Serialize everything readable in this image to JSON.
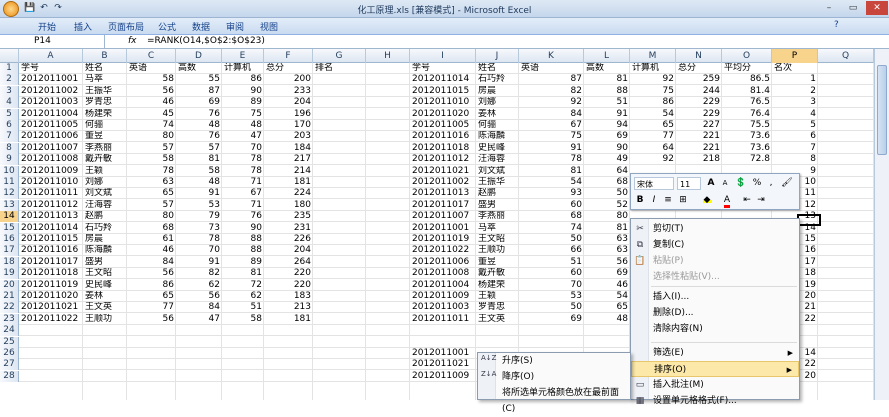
{
  "window": {
    "title": "化工原理.xls [兼容模式] - Microsoft Excel",
    "min": "–",
    "restore": "▭",
    "close": "✕"
  },
  "ribbon": {
    "tabs": [
      "开始",
      "插入",
      "页面布局",
      "公式",
      "数据",
      "审阅",
      "视图"
    ]
  },
  "formula_bar": {
    "name_box": "P14",
    "fx": "fx",
    "formula": "=RANK(O14,$O$2:$O$23)"
  },
  "columns": [
    "A",
    "B",
    "C",
    "D",
    "E",
    "F",
    "G",
    "H",
    "I",
    "J",
    "K",
    "L",
    "M",
    "N",
    "O",
    "P",
    "Q"
  ],
  "selected_column": "P",
  "selected_row": 14,
  "rows": [
    {
      "n": "1",
      "A": "学号",
      "B": "姓名",
      "C": "英语",
      "D": "高数",
      "E": "计算机",
      "F": "总分",
      "G": "排名",
      "I": "学号",
      "J": "姓名",
      "K": "英语",
      "L": "高数",
      "M": "计算机",
      "N": "总分",
      "O": "平均分",
      "P": "名次"
    },
    {
      "n": "2",
      "A": "2012011001",
      "B": "马萃",
      "C": "58",
      "D": "55",
      "E": "86",
      "F": "200",
      "I": "2012011014",
      "J": "石巧羚",
      "K": "87",
      "L": "81",
      "M": "92",
      "N": "259",
      "O": "86.5",
      "P": "1"
    },
    {
      "n": "3",
      "A": "2012011002",
      "B": "王振华",
      "C": "56",
      "D": "87",
      "E": "90",
      "F": "233",
      "I": "2012011015",
      "J": "房晨",
      "K": "82",
      "L": "88",
      "M": "75",
      "N": "244",
      "O": "81.4",
      "P": "2"
    },
    {
      "n": "4",
      "A": "2012011003",
      "B": "罗青忠",
      "C": "46",
      "D": "69",
      "E": "89",
      "F": "204",
      "I": "2012011010",
      "J": "刘娜",
      "K": "92",
      "L": "51",
      "M": "86",
      "N": "229",
      "O": "76.5",
      "P": "3"
    },
    {
      "n": "5",
      "A": "2012011004",
      "B": "杨建荣",
      "C": "45",
      "D": "76",
      "E": "75",
      "F": "196",
      "I": "2012011020",
      "J": "姜林",
      "K": "84",
      "L": "91",
      "M": "54",
      "N": "229",
      "O": "76.4",
      "P": "4"
    },
    {
      "n": "6",
      "A": "2012011005",
      "B": "何骊",
      "C": "74",
      "D": "48",
      "E": "48",
      "F": "170",
      "I": "2012011005",
      "J": "何骊",
      "K": "67",
      "L": "94",
      "M": "65",
      "N": "227",
      "O": "75.5",
      "P": "5"
    },
    {
      "n": "7",
      "A": "2012011006",
      "B": "董昱",
      "C": "80",
      "D": "76",
      "E": "47",
      "F": "203",
      "I": "2012011016",
      "J": "陈海麟",
      "K": "75",
      "L": "69",
      "M": "77",
      "N": "221",
      "O": "73.6",
      "P": "6"
    },
    {
      "n": "8",
      "A": "2012011007",
      "B": "李燕丽",
      "C": "57",
      "D": "57",
      "E": "70",
      "F": "184",
      "I": "2012011018",
      "J": "史民峰",
      "K": "91",
      "L": "90",
      "M": "64",
      "N": "221",
      "O": "73.6",
      "P": "7"
    },
    {
      "n": "9",
      "A": "2012011008",
      "B": "戴卉敏",
      "C": "58",
      "D": "81",
      "E": "78",
      "F": "217",
      "I": "2012011012",
      "J": "汪海蓉",
      "K": "78",
      "L": "49",
      "M": "92",
      "N": "218",
      "O": "72.8",
      "P": "8"
    },
    {
      "n": "10",
      "A": "2012011009",
      "B": "王颖",
      "C": "78",
      "D": "58",
      "E": "78",
      "F": "214",
      "I": "2012011021",
      "J": "刘文斌",
      "K": "81",
      "L": "64",
      "P": "9"
    },
    {
      "n": "11",
      "A": "2012011010",
      "B": "刘娜",
      "C": "63",
      "D": "48",
      "E": "71",
      "F": "181",
      "I": "2012011002",
      "J": "王振华",
      "K": "54",
      "L": "68",
      "P": "10"
    },
    {
      "n": "12",
      "A": "2012011011",
      "B": "刘文斌",
      "C": "65",
      "D": "91",
      "E": "67",
      "F": "224",
      "I": "2012011013",
      "J": "赵鹏",
      "K": "93",
      "L": "50",
      "P": "11"
    },
    {
      "n": "13",
      "A": "2012011012",
      "B": "汪海蓉",
      "C": "57",
      "D": "53",
      "E": "71",
      "F": "180",
      "I": "2012011017",
      "J": "盛男",
      "K": "60",
      "L": "52",
      "P": "12"
    },
    {
      "n": "14",
      "A": "2012011013",
      "B": "赵鹏",
      "C": "80",
      "D": "79",
      "E": "76",
      "F": "235",
      "I": "2012011007",
      "J": "李燕丽",
      "K": "68",
      "L": "80",
      "P": "13"
    },
    {
      "n": "15",
      "A": "2012011014",
      "B": "石巧羚",
      "C": "68",
      "D": "73",
      "E": "90",
      "F": "231",
      "I": "2012011001",
      "J": "马萃",
      "K": "74",
      "L": "81",
      "P": "14"
    },
    {
      "n": "16",
      "A": "2012011015",
      "B": "房晨",
      "C": "61",
      "D": "78",
      "E": "88",
      "F": "226",
      "I": "2012011019",
      "J": "王文昭",
      "K": "50",
      "L": "63",
      "P": "15"
    },
    {
      "n": "17",
      "A": "2012011016",
      "B": "陈海麟",
      "C": "46",
      "D": "70",
      "E": "88",
      "F": "204",
      "I": "2012011022",
      "J": "王顺功",
      "K": "66",
      "L": "63",
      "P": "16"
    },
    {
      "n": "18",
      "A": "2012011017",
      "B": "盛男",
      "C": "84",
      "D": "91",
      "E": "89",
      "F": "264",
      "I": "2012011006",
      "J": "董昱",
      "K": "51",
      "L": "56",
      "P": "17"
    },
    {
      "n": "19",
      "A": "2012011018",
      "B": "王文昭",
      "C": "56",
      "D": "82",
      "E": "81",
      "F": "220",
      "I": "2012011008",
      "J": "戴卉敏",
      "K": "60",
      "L": "69",
      "P": "18"
    },
    {
      "n": "20",
      "A": "2012011019",
      "B": "史民峰",
      "C": "86",
      "D": "62",
      "E": "72",
      "F": "220",
      "I": "2012011004",
      "J": "杨建荣",
      "K": "70",
      "L": "46",
      "P": "19"
    },
    {
      "n": "21",
      "A": "2012011020",
      "B": "姜林",
      "C": "65",
      "D": "56",
      "E": "62",
      "F": "183",
      "I": "2012011009",
      "J": "王颖",
      "K": "53",
      "L": "54",
      "P": "20"
    },
    {
      "n": "22",
      "A": "2012011021",
      "B": "王文英",
      "C": "77",
      "D": "84",
      "E": "51",
      "F": "213",
      "I": "2012011003",
      "J": "罗青忠",
      "K": "50",
      "L": "65",
      "P": "21"
    },
    {
      "n": "23",
      "A": "2012011022",
      "B": "王顺功",
      "C": "56",
      "D": "47",
      "E": "58",
      "F": "181",
      "I": "2012011011",
      "J": "王文英",
      "K": "69",
      "L": "48",
      "P": "22"
    },
    {
      "n": "24"
    },
    {
      "n": "25"
    },
    {
      "n": "26",
      "I": "2012011001",
      "P": "14"
    },
    {
      "n": "27",
      "I": "2012011021",
      "P": "22"
    },
    {
      "n": "28",
      "I": "2012011009",
      "P": "20"
    }
  ],
  "mini_toolbar": {
    "font": "宋体",
    "size": "11",
    "grow": "A",
    "shrink": "A",
    "format": "%",
    "comma": ",",
    "bold": "B",
    "italic": "I",
    "align": "≡",
    "fill_color": "#ffff00",
    "font_color": "#ff0000"
  },
  "context_menu": {
    "items": [
      {
        "label": "剪切(T)",
        "icon": "✂"
      },
      {
        "label": "复制(C)",
        "icon": "⧉"
      },
      {
        "label": "粘贴(P)",
        "icon": "📋",
        "disabled": true
      },
      {
        "label": "选择性粘贴(V)...",
        "disabled": true
      },
      {
        "label": "插入(I)..."
      },
      {
        "label": "删除(D)..."
      },
      {
        "label": "清除内容(N)"
      },
      {
        "label": "筛选(E)",
        "submenu": true
      },
      {
        "label": "排序(O)",
        "submenu": true,
        "highlighted": true
      },
      {
        "label": "插入批注(M)",
        "icon": "▭"
      },
      {
        "label": "设置单元格格式(F)...",
        "icon": "▦"
      }
    ]
  },
  "sort_submenu": {
    "items": [
      {
        "label": "升序(S)",
        "icon": "A↓Z"
      },
      {
        "label": "降序(O)",
        "icon": "Z↓A"
      },
      {
        "label": "将所选单元格颜色放在最前面(C)"
      }
    ]
  }
}
